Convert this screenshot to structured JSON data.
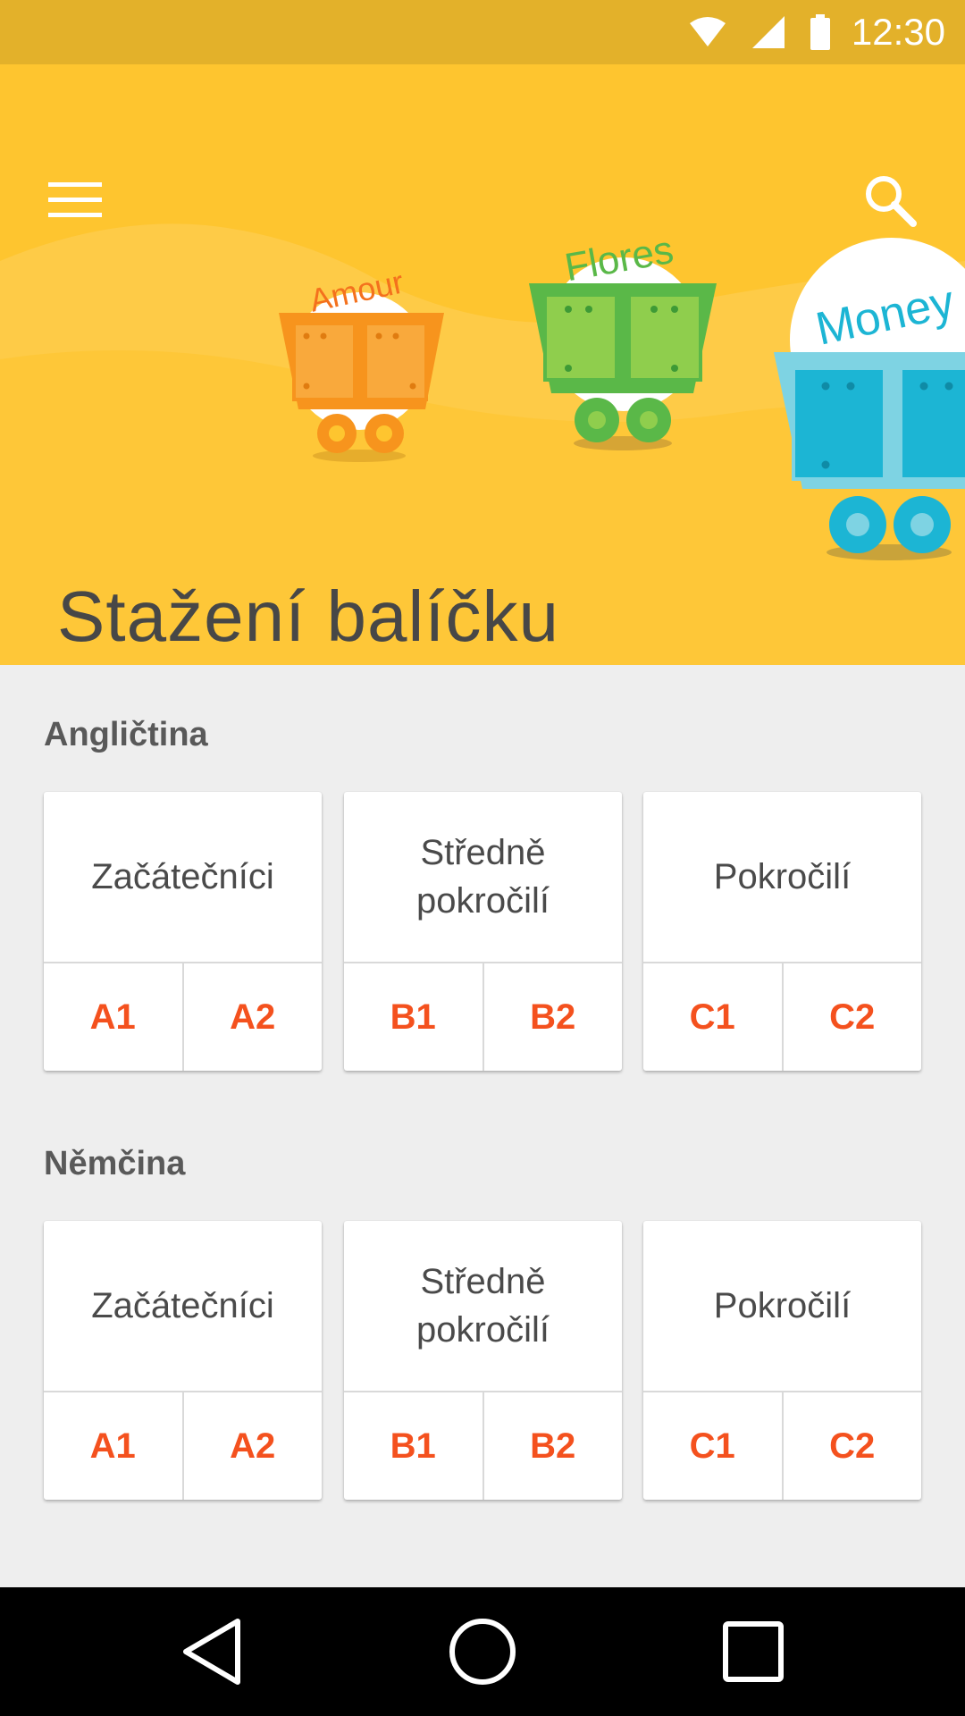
{
  "status_bar": {
    "time": "12:30",
    "icons": [
      "wifi-icon",
      "cell-signal-icon",
      "battery-icon"
    ]
  },
  "header": {
    "menu_icon": "menu-icon",
    "search_icon": "search-icon",
    "title": "Stažení balíčku",
    "background_color": "#fec52f",
    "carts": [
      {
        "word": "Amour",
        "color": "#f7941d"
      },
      {
        "word": "Flores",
        "color": "#5ab848"
      },
      {
        "word": "Money",
        "color": "#29b6d3"
      }
    ]
  },
  "sections": [
    {
      "title": "Angličtina",
      "cards": [
        {
          "name": "Začátečníci",
          "levels": [
            "A1",
            "A2"
          ]
        },
        {
          "name": "Středně pokročilí",
          "levels": [
            "B1",
            "B2"
          ]
        },
        {
          "name": "Pokročilí",
          "levels": [
            "C1",
            "C2"
          ]
        }
      ]
    },
    {
      "title": "Němčina",
      "cards": [
        {
          "name": "Začátečníci",
          "levels": [
            "A1",
            "A2"
          ]
        },
        {
          "name": "Středně pokročilí",
          "levels": [
            "B1",
            "B2"
          ]
        },
        {
          "name": "Pokročilí",
          "levels": [
            "C1",
            "C2"
          ]
        }
      ]
    }
  ],
  "nav_bar": {
    "icons": [
      "back-icon",
      "home-icon",
      "recents-icon"
    ]
  },
  "colors": {
    "accent": "#f4511e",
    "status_bar": "#e3b12a",
    "page_background": "#eeeeee"
  }
}
